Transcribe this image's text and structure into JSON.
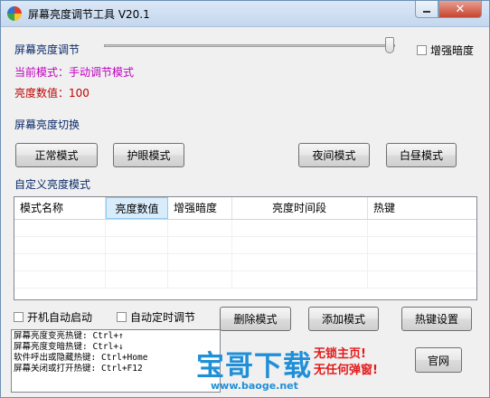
{
  "window": {
    "title": "屏幕亮度调节工具 V20.1",
    "close_glyph": "✕"
  },
  "brightness": {
    "adjust_label": "屏幕亮度调节",
    "enhance_dark_label": "增强暗度",
    "enhance_dark_checked": false,
    "slider_level": 1.0,
    "current_mode_label": "当前模式：手动调节模式",
    "value_label": "亮度数值：100"
  },
  "mode_switch": {
    "section_label": "屏幕亮度切换",
    "buttons": [
      "正常模式",
      "护眼模式",
      "夜间模式",
      "白昼模式"
    ]
  },
  "custom": {
    "section_label": "自定义亮度模式",
    "columns": [
      "模式名称",
      "亮度数值",
      "增强暗度",
      "亮度时间段",
      "热键"
    ],
    "selected_column": "亮度数值",
    "rows": []
  },
  "options": {
    "auto_start_label": "开机自动启动",
    "auto_start_checked": false,
    "timed_adjust_label": "自动定时调节",
    "timed_adjust_checked": false
  },
  "actions": {
    "delete_label": "删除模式",
    "add_label": "添加模式",
    "hotkey_label": "热键设置",
    "official_label": "官网"
  },
  "hotkeys": [
    "屏幕亮度变亮热键: Ctrl+↑",
    "屏幕亮度变暗热键: Ctrl+↓",
    "软件呼出或隐藏热键: Ctrl+Home",
    "屏幕关闭或打开热键: Ctrl+F12"
  ],
  "watermark": {
    "logo": "宝哥下载",
    "url": "www.baoge.net",
    "slogan_1": "无锁主页!",
    "slogan_2": "无任何弹窗!"
  },
  "colors": {
    "accent_purple": "#c000c0",
    "value_red": "#c00000",
    "section_blue": "#0a2a6a",
    "watermark_blue": "#1f8fd8",
    "watermark_red": "#e21b1b"
  }
}
